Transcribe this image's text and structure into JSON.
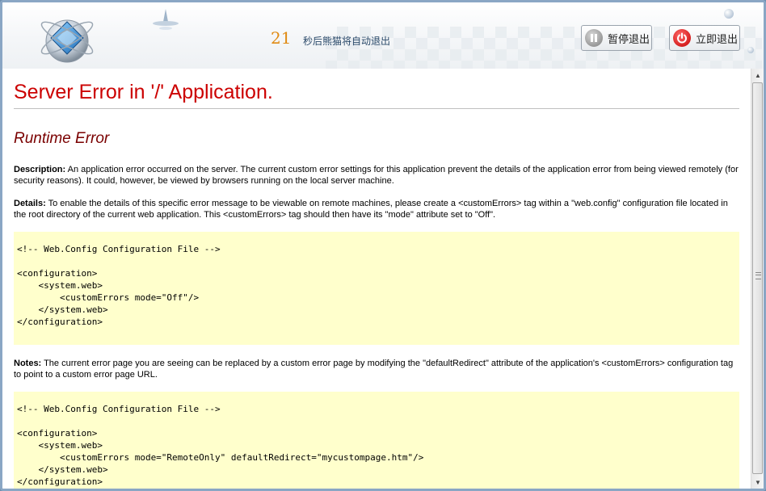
{
  "header": {
    "countdown_number": "21",
    "countdown_text": "秒后熊猫将自动退出",
    "pause_label": "暂停退出",
    "exit_label": "立即退出"
  },
  "page": {
    "title": "Server Error in '/' Application.",
    "subtitle": "Runtime Error",
    "description_label": "Description:",
    "description_text": " An application error occurred on the server. The current custom error settings for this application prevent the details of the application error from being viewed remotely (for security reasons). It could, however, be viewed by browsers running on the local server machine.",
    "details_label": "Details:",
    "details_text": " To enable the details of this specific error message to be viewable on remote machines, please create a <customErrors> tag within a \"web.config\" configuration file located in the root directory of the current web application. This <customErrors> tag should then have its \"mode\" attribute set to \"Off\".",
    "code1": [
      "<!-- Web.Config Configuration File -->",
      "",
      "<configuration>",
      "    <system.web>",
      "        <customErrors mode=\"Off\"/>",
      "    </system.web>",
      "</configuration>"
    ],
    "notes_label": "Notes:",
    "notes_text": " The current error page you are seeing can be replaced by a custom error page by modifying the \"defaultRedirect\" attribute of the application's <customErrors> configuration tag to point to a custom error page URL.",
    "code2": [
      "<!-- Web.Config Configuration File -->",
      "",
      "<configuration>",
      "    <system.web>",
      "        <customErrors mode=\"RemoteOnly\" defaultRedirect=\"mycustompage.htm\"/>",
      "    </system.web>",
      "</configuration>"
    ]
  },
  "colors": {
    "title": "#cc0000",
    "subtitle": "#7a0000",
    "code_background": "#ffffcc",
    "countdown": "#e08a12"
  },
  "icons": {
    "logo": "panda-globe-logo",
    "pause": "pause-icon",
    "exit": "power-icon"
  }
}
